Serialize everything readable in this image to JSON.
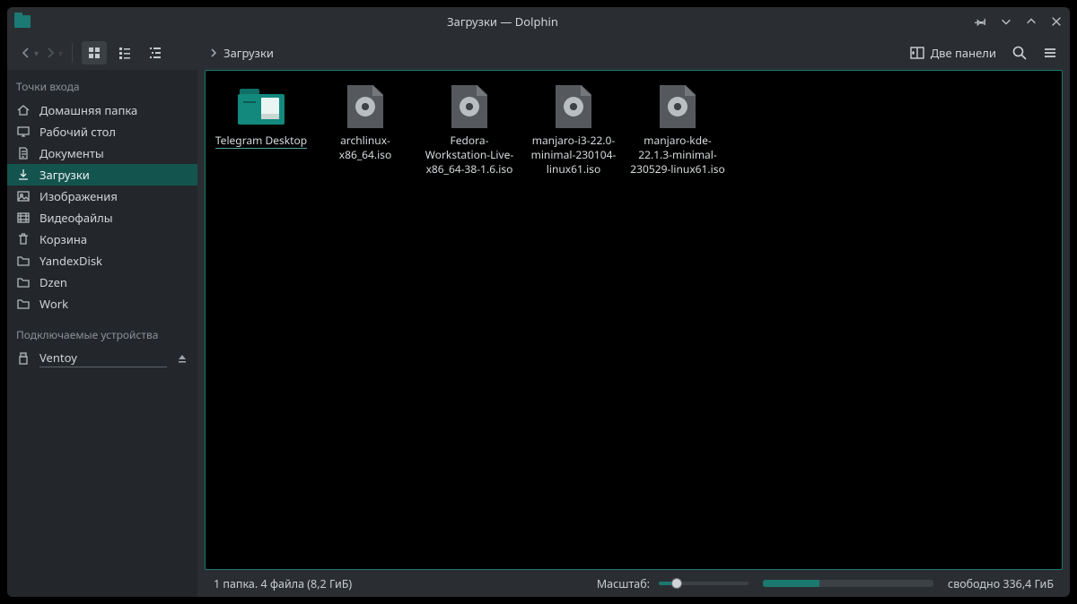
{
  "window": {
    "title": "Загрузки — Dolphin"
  },
  "toolbar": {
    "breadcrumb": "Загрузки",
    "split_view": "Две панели"
  },
  "sidebar": {
    "section_places": "Точки входа",
    "section_devices": "Подключаемые устройства",
    "items": [
      {
        "id": "home",
        "label": "Домашняя папка",
        "icon": "home"
      },
      {
        "id": "desktop",
        "label": "Рабочий стол",
        "icon": "desktop"
      },
      {
        "id": "documents",
        "label": "Документы",
        "icon": "doc"
      },
      {
        "id": "downloads",
        "label": "Загрузки",
        "icon": "download",
        "active": true
      },
      {
        "id": "pictures",
        "label": "Изображения",
        "icon": "pictures"
      },
      {
        "id": "videos",
        "label": "Видеофайлы",
        "icon": "video"
      },
      {
        "id": "trash",
        "label": "Корзина",
        "icon": "trash"
      },
      {
        "id": "yandex",
        "label": "YandexDisk",
        "icon": "folder"
      },
      {
        "id": "dzen",
        "label": "Dzen",
        "icon": "folder"
      },
      {
        "id": "work",
        "label": "Work",
        "icon": "folder"
      }
    ],
    "devices": [
      {
        "id": "ventoy",
        "label": "Ventoy",
        "icon": "usb"
      }
    ]
  },
  "files": [
    {
      "name": "Telegram Desktop",
      "type": "folder",
      "selected": true
    },
    {
      "name": "archlinux-x86_64.iso",
      "type": "iso"
    },
    {
      "name": "Fedora-Workstation-Live-x86_64-38-1.6.iso",
      "type": "iso"
    },
    {
      "name": "manjaro-i3-22.0-minimal-230104-linux61.iso",
      "type": "iso"
    },
    {
      "name": "manjaro-kde-22.1.3-minimal-230529-linux61.iso",
      "type": "iso"
    }
  ],
  "status": {
    "summary": "1 папка. 4 файла (8,2 ГиБ)",
    "zoom_label": "Масштаб:",
    "free_space": "свободно 336,4 ГиБ"
  }
}
